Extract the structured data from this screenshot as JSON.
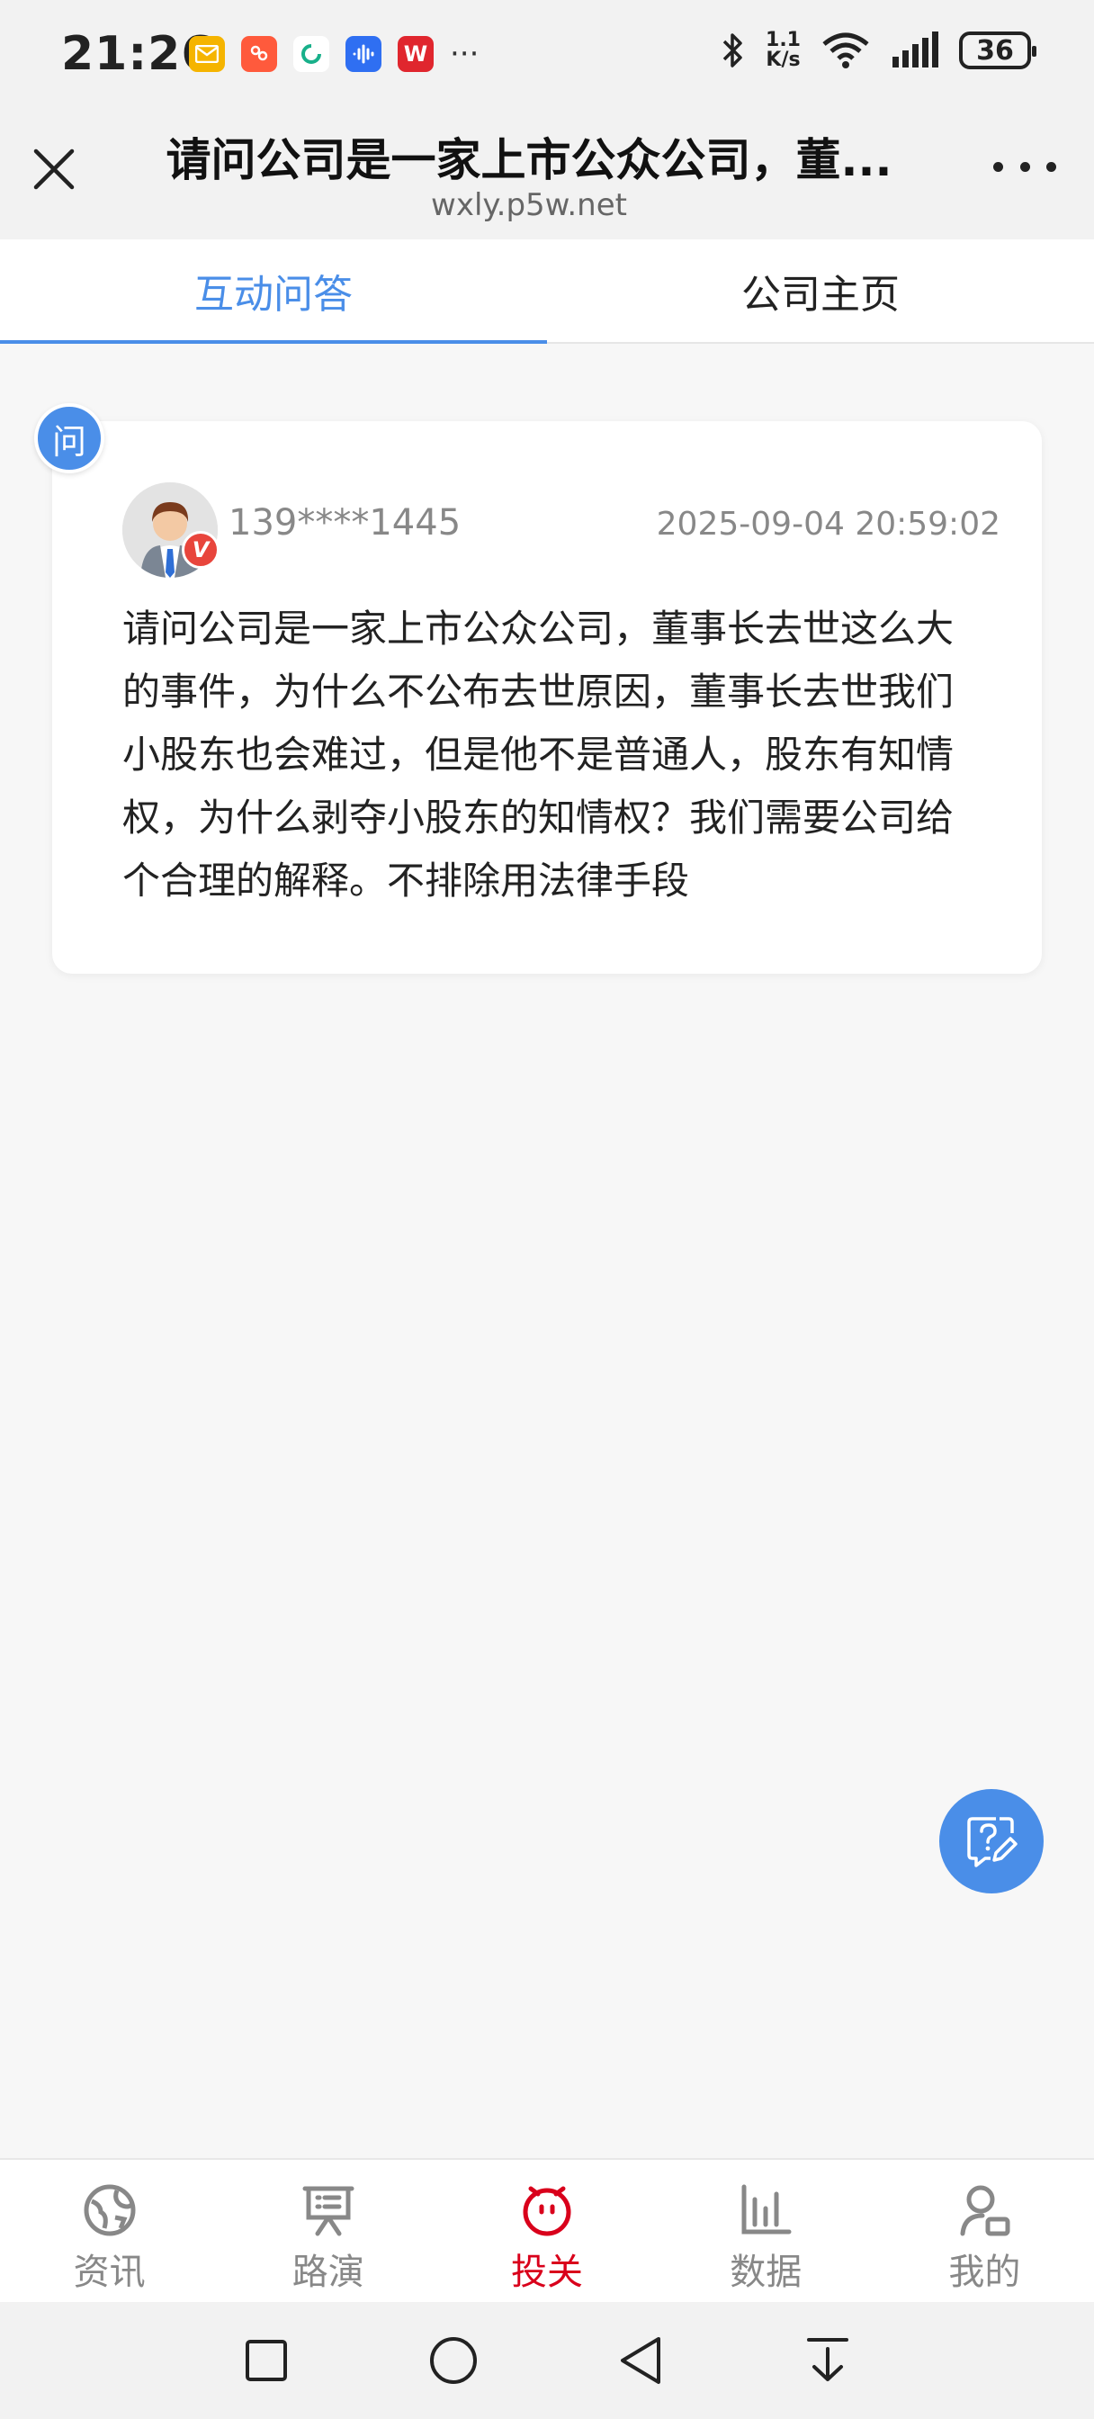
{
  "status_bar": {
    "time": "21:26",
    "net_speed_top": "1.1",
    "net_speed_bottom": "K/s",
    "battery": "36",
    "more": "···",
    "app_icons": [
      "mail-app-icon",
      "shopping-app-icon",
      "refresh-app-icon",
      "voice-app-icon",
      "wps-app-icon"
    ]
  },
  "header": {
    "title": "请问公司是一家上市公众公司，董...",
    "url": "wxly.p5w.net"
  },
  "tabs": [
    {
      "label": "互动问答",
      "active": true
    },
    {
      "label": "公司主页",
      "active": false
    }
  ],
  "question": {
    "badge": "问",
    "user": "139****1445",
    "verified_mark": "V",
    "time": "2025-09-04 20:59:02",
    "text": "请问公司是一家上市公众公司，董事长去世这么大的事件，为什么不公布去世原因，董事长去世我们小股东也会难过，但是他不是普通人，股东有知情权，为什么剥夺小股东的知情权？我们需要公司给个合理的解释。不排除用法律手段"
  },
  "bottom_nav": [
    {
      "label": "资讯",
      "icon": "globe-icon",
      "active": false
    },
    {
      "label": "路演",
      "icon": "presentation-icon",
      "active": false
    },
    {
      "label": "投关",
      "icon": "smile-icon",
      "active": true
    },
    {
      "label": "数据",
      "icon": "bar-chart-icon",
      "active": false
    },
    {
      "label": "我的",
      "icon": "user-icon",
      "active": false
    }
  ],
  "colors": {
    "accent": "#4a8ee8",
    "active_nav": "#d9001b",
    "muted": "#888888"
  }
}
